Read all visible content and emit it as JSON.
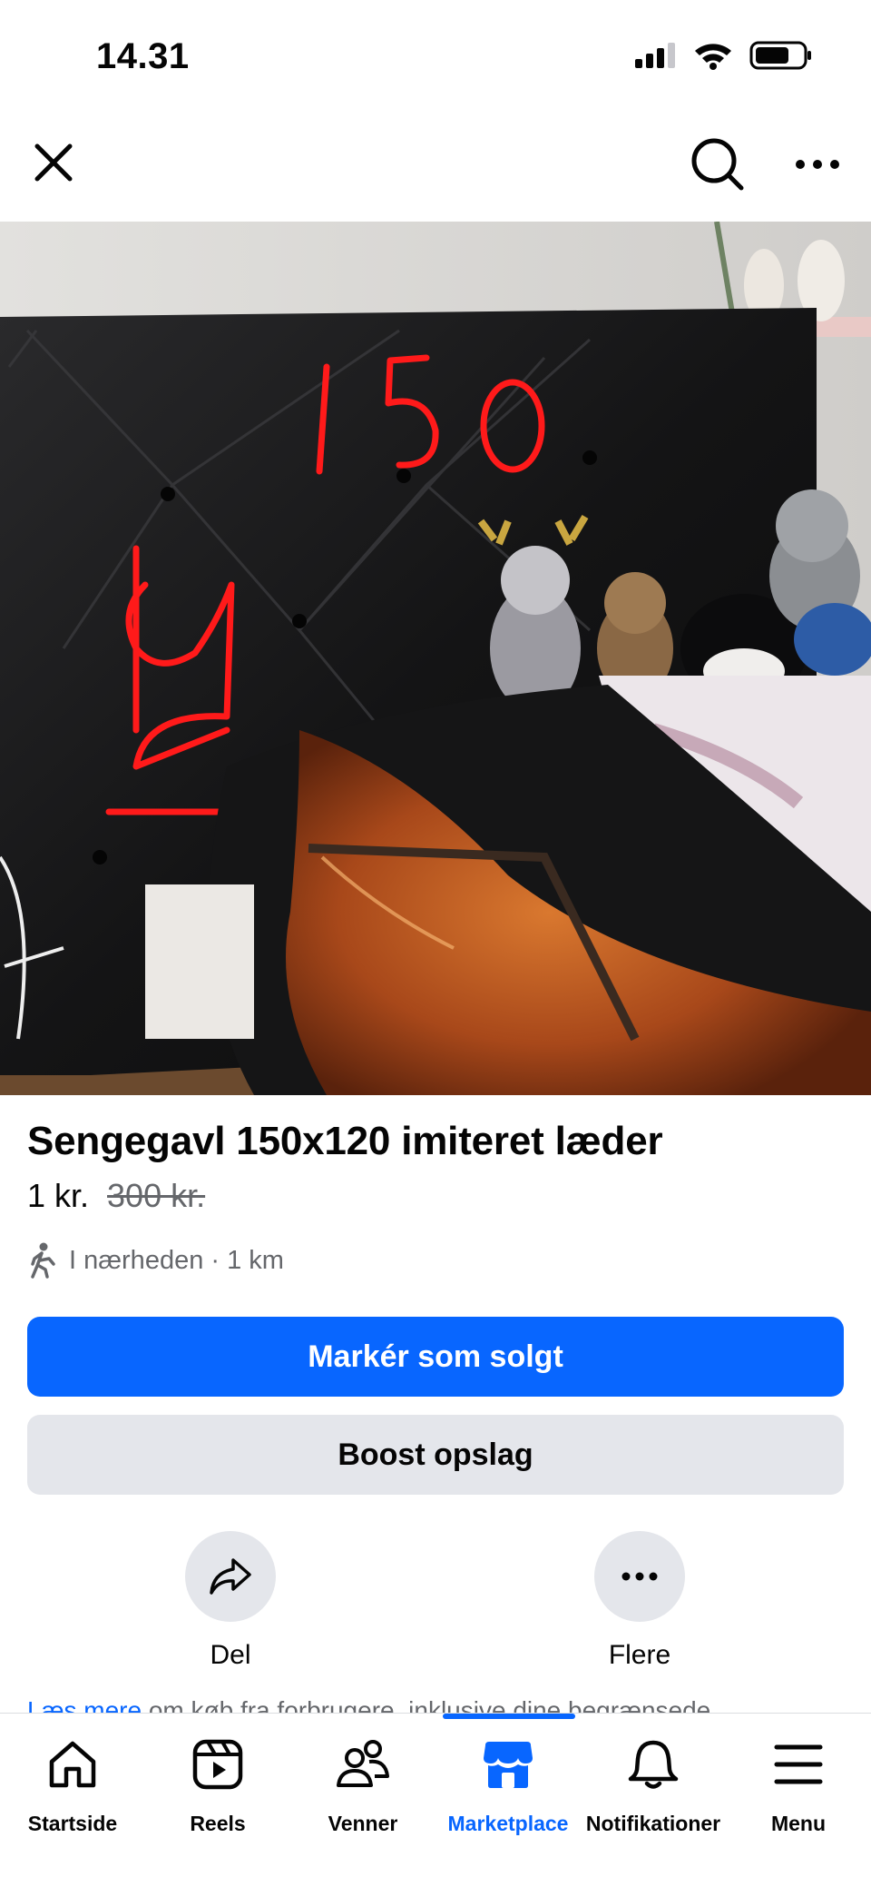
{
  "status_bar": {
    "time": "14.31"
  },
  "top_bar": {
    "icons": [
      "close-icon",
      "search-icon",
      "more-icon"
    ]
  },
  "photo": {
    "handwritten_numbers": [
      "150",
      "120"
    ]
  },
  "listing": {
    "title": "Sengegavl 150x120 imiteret læder",
    "price": "1 kr.",
    "old_price": "300 kr.",
    "location": "I nærheden · 1 km"
  },
  "buttons": {
    "mark_sold": "Markér som solgt",
    "boost": "Boost opslag"
  },
  "actions": {
    "share": "Del",
    "more": "Flere"
  },
  "read_more": {
    "link": "Læs mere",
    "text": " om køb fra forbrugere, inklusive dine begrænsede"
  },
  "bottom_nav": {
    "items": [
      {
        "label": "Startside",
        "icon": "home-icon"
      },
      {
        "label": "Reels",
        "icon": "reels-icon"
      },
      {
        "label": "Venner",
        "icon": "friends-icon"
      },
      {
        "label": "Marketplace",
        "icon": "marketplace-icon",
        "active": true
      },
      {
        "label": "Notifikationer",
        "icon": "bell-icon"
      },
      {
        "label": "Menu",
        "icon": "menu-icon"
      }
    ]
  },
  "colors": {
    "accent": "#0866ff",
    "secondary_button": "#e4e6eb",
    "muted_text": "#65676b",
    "handwriting": "#ff1a1a"
  }
}
